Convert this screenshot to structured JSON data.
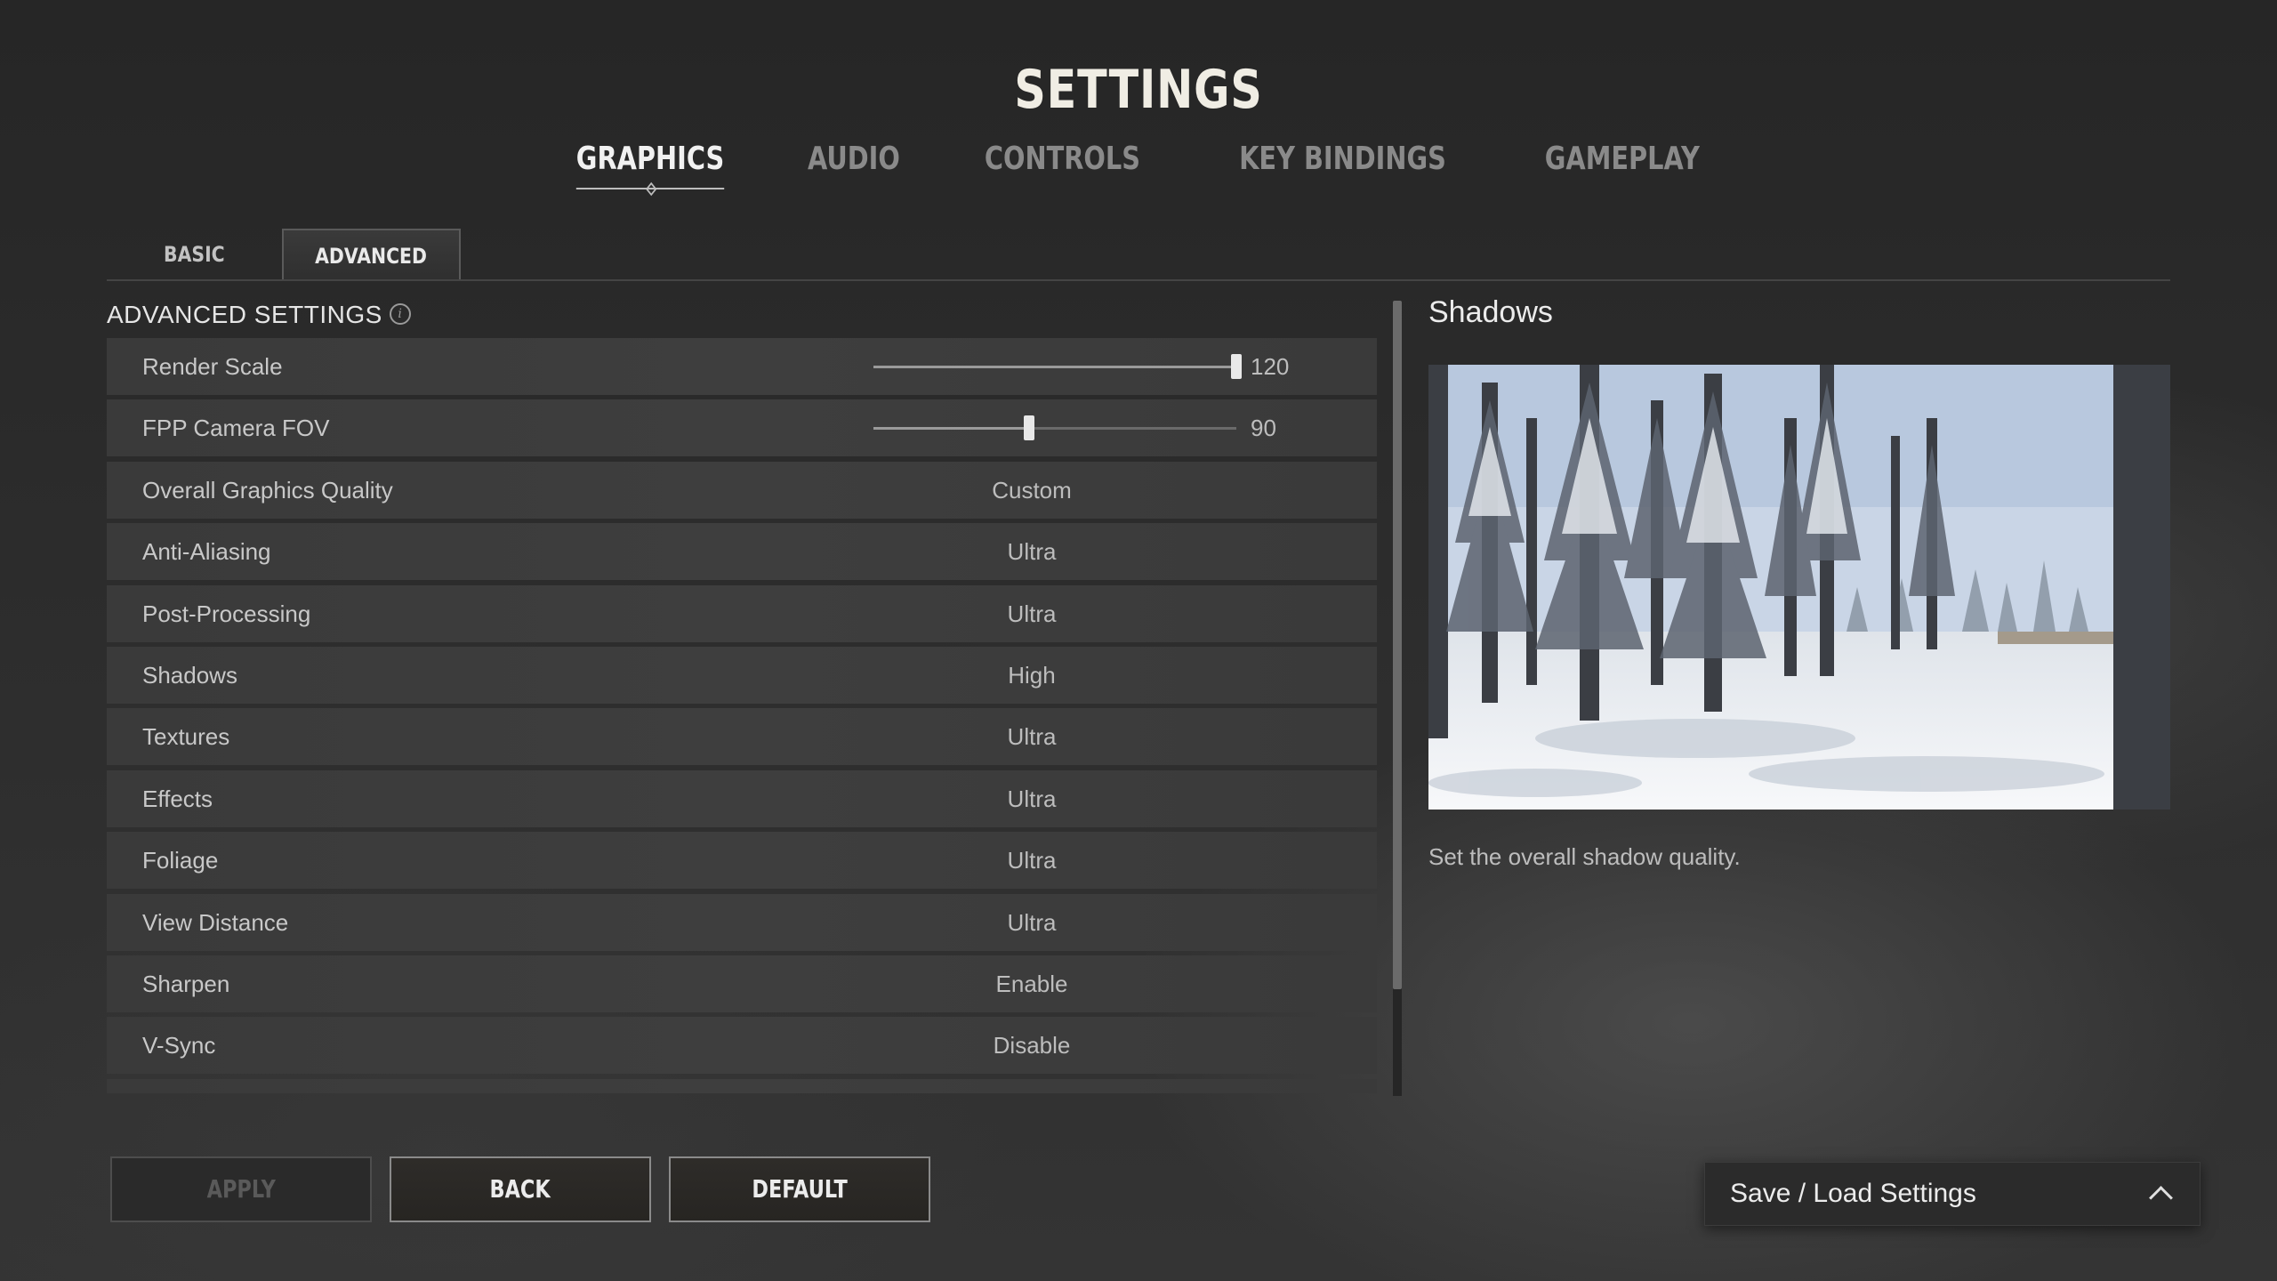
{
  "header": {
    "title": "SETTINGS"
  },
  "top_tabs": [
    {
      "label": "GRAPHICS",
      "active": true
    },
    {
      "label": "AUDIO",
      "active": false
    },
    {
      "label": "CONTROLS",
      "active": false
    },
    {
      "label": "KEY BINDINGS",
      "active": false
    },
    {
      "label": "GAMEPLAY",
      "active": false
    }
  ],
  "sub_tabs": [
    {
      "label": "BASIC",
      "active": false
    },
    {
      "label": "ADVANCED",
      "active": true
    }
  ],
  "section": {
    "title": "ADVANCED SETTINGS",
    "info_icon": "info-icon"
  },
  "settings": {
    "render_scale": {
      "label": "Render Scale",
      "value": "120",
      "fraction": 1.0
    },
    "fpp_fov": {
      "label": "FPP Camera FOV",
      "value": "90",
      "fraction": 0.43
    },
    "rows": [
      {
        "label": "Overall Graphics Quality",
        "value": "Custom"
      },
      {
        "label": "Anti-Aliasing",
        "value": "Ultra"
      },
      {
        "label": "Post-Processing",
        "value": "Ultra"
      },
      {
        "label": "Shadows",
        "value": "High"
      },
      {
        "label": "Textures",
        "value": "Ultra"
      },
      {
        "label": "Effects",
        "value": "Ultra"
      },
      {
        "label": "Foliage",
        "value": "Ultra"
      },
      {
        "label": "View Distance",
        "value": "Ultra"
      },
      {
        "label": "Sharpen",
        "value": "Enable"
      },
      {
        "label": "V-Sync",
        "value": "Disable"
      }
    ]
  },
  "preview": {
    "title": "Shadows",
    "description": "Set the overall shadow quality."
  },
  "buttons": {
    "apply": "APPLY",
    "back": "BACK",
    "default": "DEFAULT"
  },
  "save_load": {
    "label": "Save / Load Settings",
    "icon": "chevron-up-icon"
  }
}
